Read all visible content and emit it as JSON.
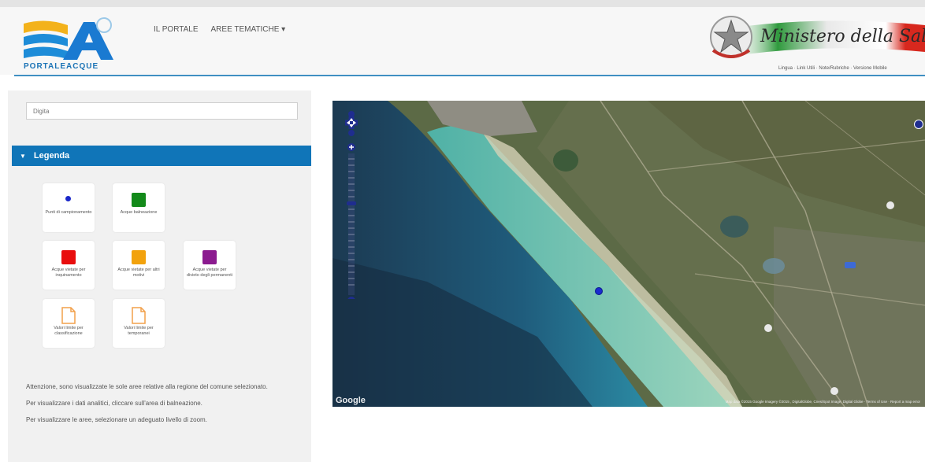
{
  "brand": {
    "logo_text": "PORTALEACQUE"
  },
  "nav": {
    "items": [
      "IL PORTALE",
      "AREE TEMATICHE ▾"
    ]
  },
  "ministry": {
    "name": "Ministero della Salute",
    "links": "Lingua · Link Utili · Note/Rubriche · Versione Mobile"
  },
  "sidebar": {
    "search_placeholder": "Digita",
    "legend": {
      "title": "Legenda"
    },
    "legend_items": [
      {
        "label": "Punti di campionamento",
        "color": "#1a27c9",
        "kind": "dot"
      },
      {
        "label": "Acque balneazione",
        "color": "#138a1a",
        "kind": "square"
      },
      {
        "label": "Acque vietate per inquinamento",
        "color": "#e80d0d",
        "kind": "square"
      },
      {
        "label": "Acque vietate per altri motivi",
        "color": "#f2a20d",
        "kind": "square"
      },
      {
        "label": "Acque vietate per divieto degli permanenti",
        "color": "#8b1b8f",
        "kind": "square"
      },
      {
        "label": "Valori limite per classificazione",
        "color": "#f2a04a",
        "kind": "document-icon"
      },
      {
        "label": "Valori limite per temporanei",
        "color": "#f2a04a",
        "kind": "document-icon"
      }
    ],
    "notes": [
      "Attenzione, sono visualizzate le sole aree relative alla regione del comune selezionato.",
      "Per visualizzare i dati analitici, cliccare sull'area di balneazione.",
      "Per visualizzare le aree, selezionare un adeguato livello di zoom."
    ]
  },
  "map": {
    "attribution": "Map data ©2015 Google Imagery ©2015 , DigitalGlobe, Cnes/Spot Image, Digital Globe · Terms of Use · Report a map error",
    "google_label": "Google"
  }
}
